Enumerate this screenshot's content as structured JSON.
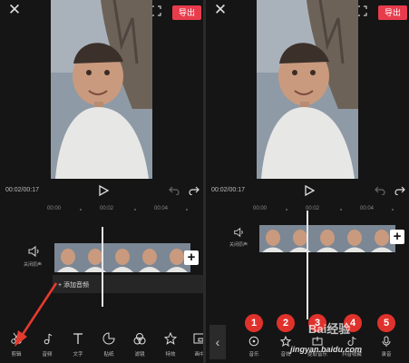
{
  "brand": {
    "accent": "#e83c4c",
    "badge": "#e0322c"
  },
  "left": {
    "export_label": "导出",
    "time": "00:02/00:17",
    "ruler": [
      "00:00",
      "00:02",
      "00:04"
    ],
    "audio_label": "关闭原声",
    "add_audio": "+ 添加音频",
    "tools": [
      {
        "label": "剪辑",
        "icon": "scissors-icon"
      },
      {
        "label": "音频",
        "icon": "music-note-icon"
      },
      {
        "label": "文字",
        "icon": "text-icon"
      },
      {
        "label": "贴纸",
        "icon": "sticker-icon"
      },
      {
        "label": "滤镜",
        "icon": "filter-icon"
      },
      {
        "label": "特效",
        "icon": "effects-icon"
      },
      {
        "label": "画中",
        "icon": "pip-icon"
      }
    ]
  },
  "right": {
    "export_label": "导出",
    "time": "00:02/00:17",
    "ruler": [
      "00:00",
      "00:02",
      "00:04"
    ],
    "audio_label": "关闭原声",
    "badges": [
      "1",
      "2",
      "3",
      "4",
      "5"
    ],
    "tools": [
      {
        "label": "音乐",
        "icon": "music-disc-icon"
      },
      {
        "label": "音效",
        "icon": "star-icon"
      },
      {
        "label": "提取音乐",
        "icon": "extract-icon"
      },
      {
        "label": "抖音收藏",
        "icon": "tiktok-icon"
      },
      {
        "label": "录音",
        "icon": "mic-icon"
      }
    ],
    "watermark": "Bai经验",
    "watermark_url": "jingyan.baidu.com"
  }
}
